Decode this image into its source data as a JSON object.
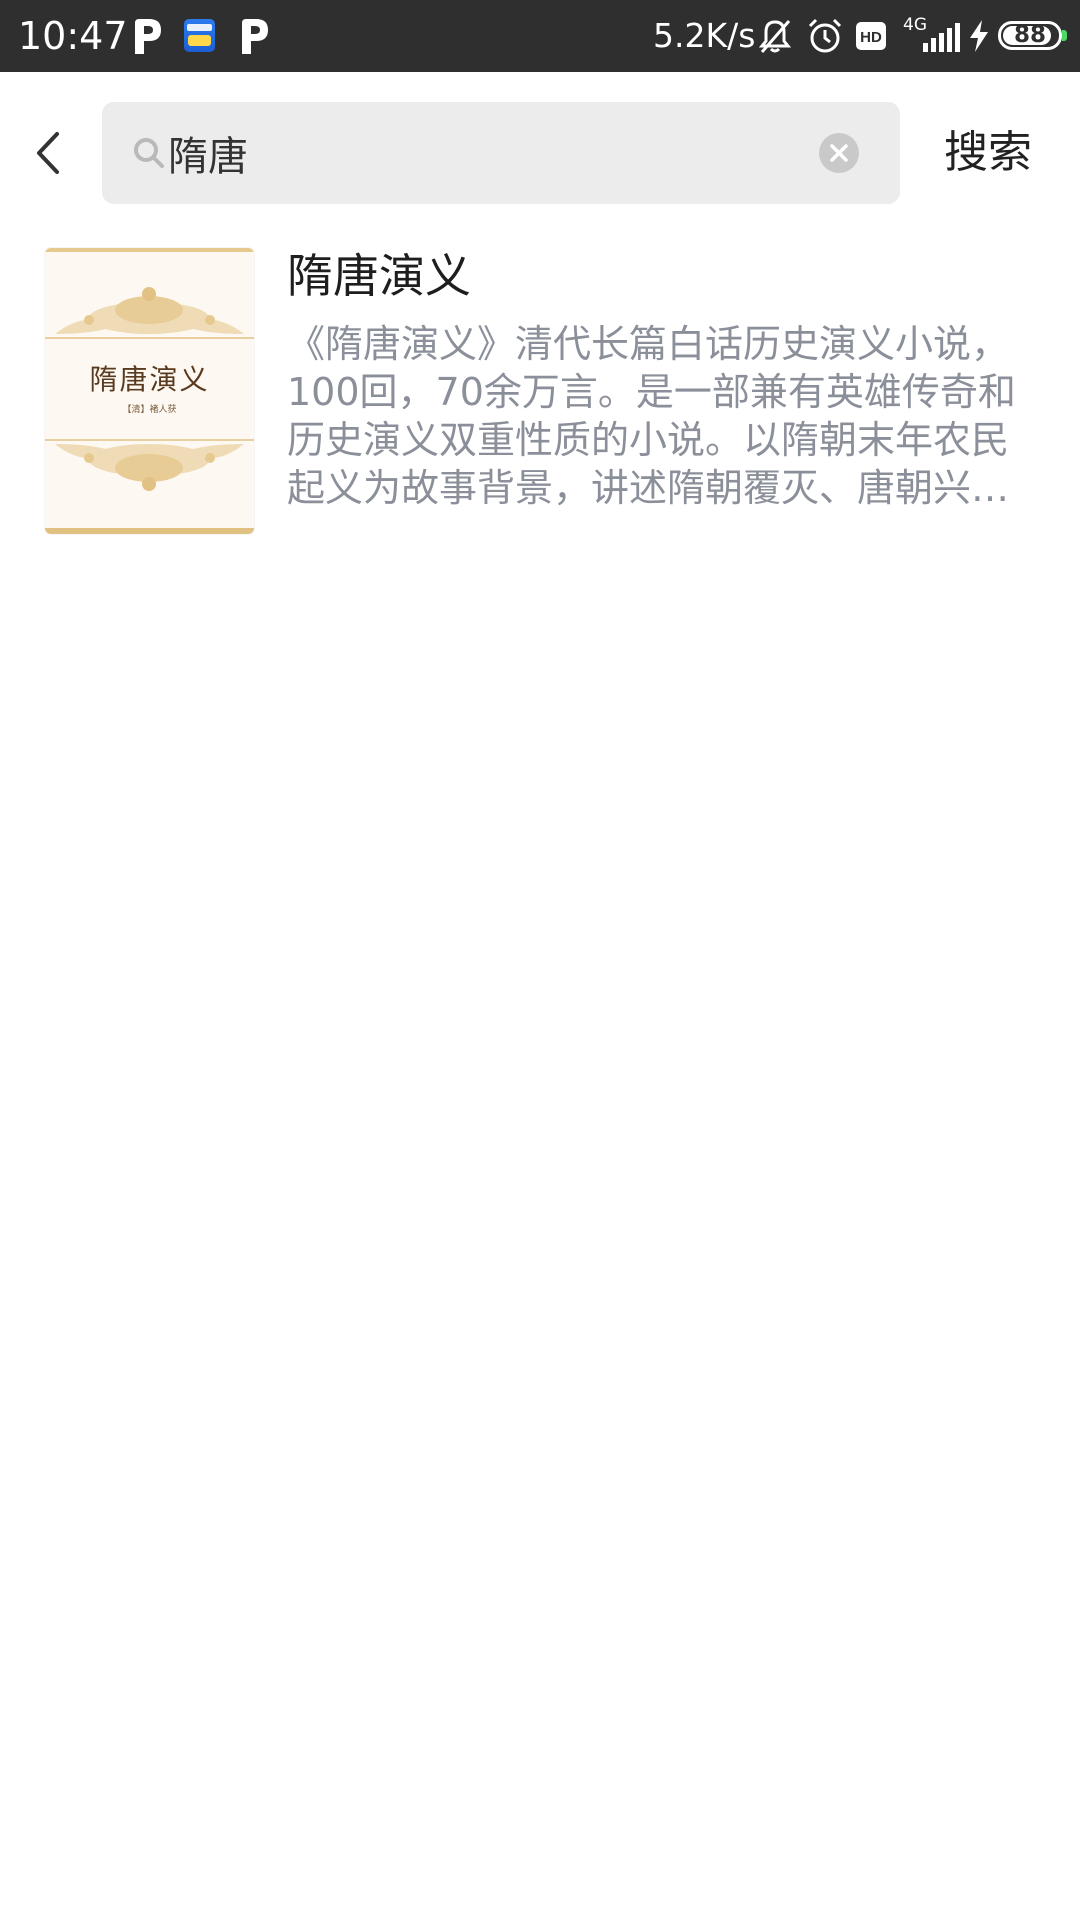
{
  "status_bar": {
    "time": "10:47",
    "network_speed": "5.2K/s",
    "network_type": "4G",
    "hd_label": "HD",
    "battery_level": "88",
    "battery_fraction": 0.88,
    "notification_icons": [
      "p-app-icon",
      "news-app-icon",
      "p-app-icon"
    ],
    "indicator_icons": [
      "bell-muted-icon",
      "alarm-icon",
      "hd-icon",
      "signal-icon",
      "charging-icon",
      "battery-icon"
    ]
  },
  "header": {
    "back_icon": "chevron-left-icon",
    "search_icon": "search-icon",
    "search_value": "隋唐",
    "clear_icon": "clear-icon",
    "search_button_label": "搜索"
  },
  "results": [
    {
      "cover_title": "隋唐演义",
      "cover_author": "【清】褚人获",
      "title": "隋唐演义",
      "description": "《隋唐演义》清代长篇白话历史演义小说，100回，70余万言。是一部兼有英雄传奇和历史演义双重性质的小说。以隋朝末年农民起义为故事背景，讲述隋朝覆灭、唐朝兴起的历史故事。"
    }
  ],
  "colors": {
    "status_bar_bg": "#2f2f2f",
    "search_box_bg": "#ececec",
    "description_text": "#8a8f99",
    "cover_gold": "#e0c182"
  }
}
